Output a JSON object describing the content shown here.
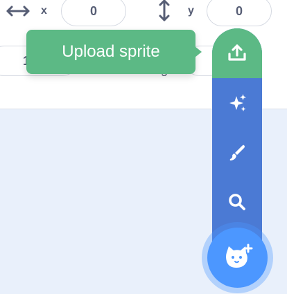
{
  "sprite_info": {
    "x_label": "x",
    "x_value": "0",
    "y_label": "y",
    "y_value": "0",
    "size_value_partial": "1",
    "direction_label_partial": "g"
  },
  "tooltip": {
    "text": "Upload sprite"
  },
  "sprite_menu": {
    "items": [
      {
        "icon": "upload-icon"
      },
      {
        "icon": "sparkle-icon"
      },
      {
        "icon": "paintbrush-icon"
      },
      {
        "icon": "search-icon"
      }
    ],
    "main_button_icon": "cat-add-icon"
  },
  "colors": {
    "upload": "#5cb985",
    "menu": "#4b7ad4",
    "fab": "#4c97ff",
    "text": "#575e75",
    "stage_bg": "#e9f0fb"
  }
}
